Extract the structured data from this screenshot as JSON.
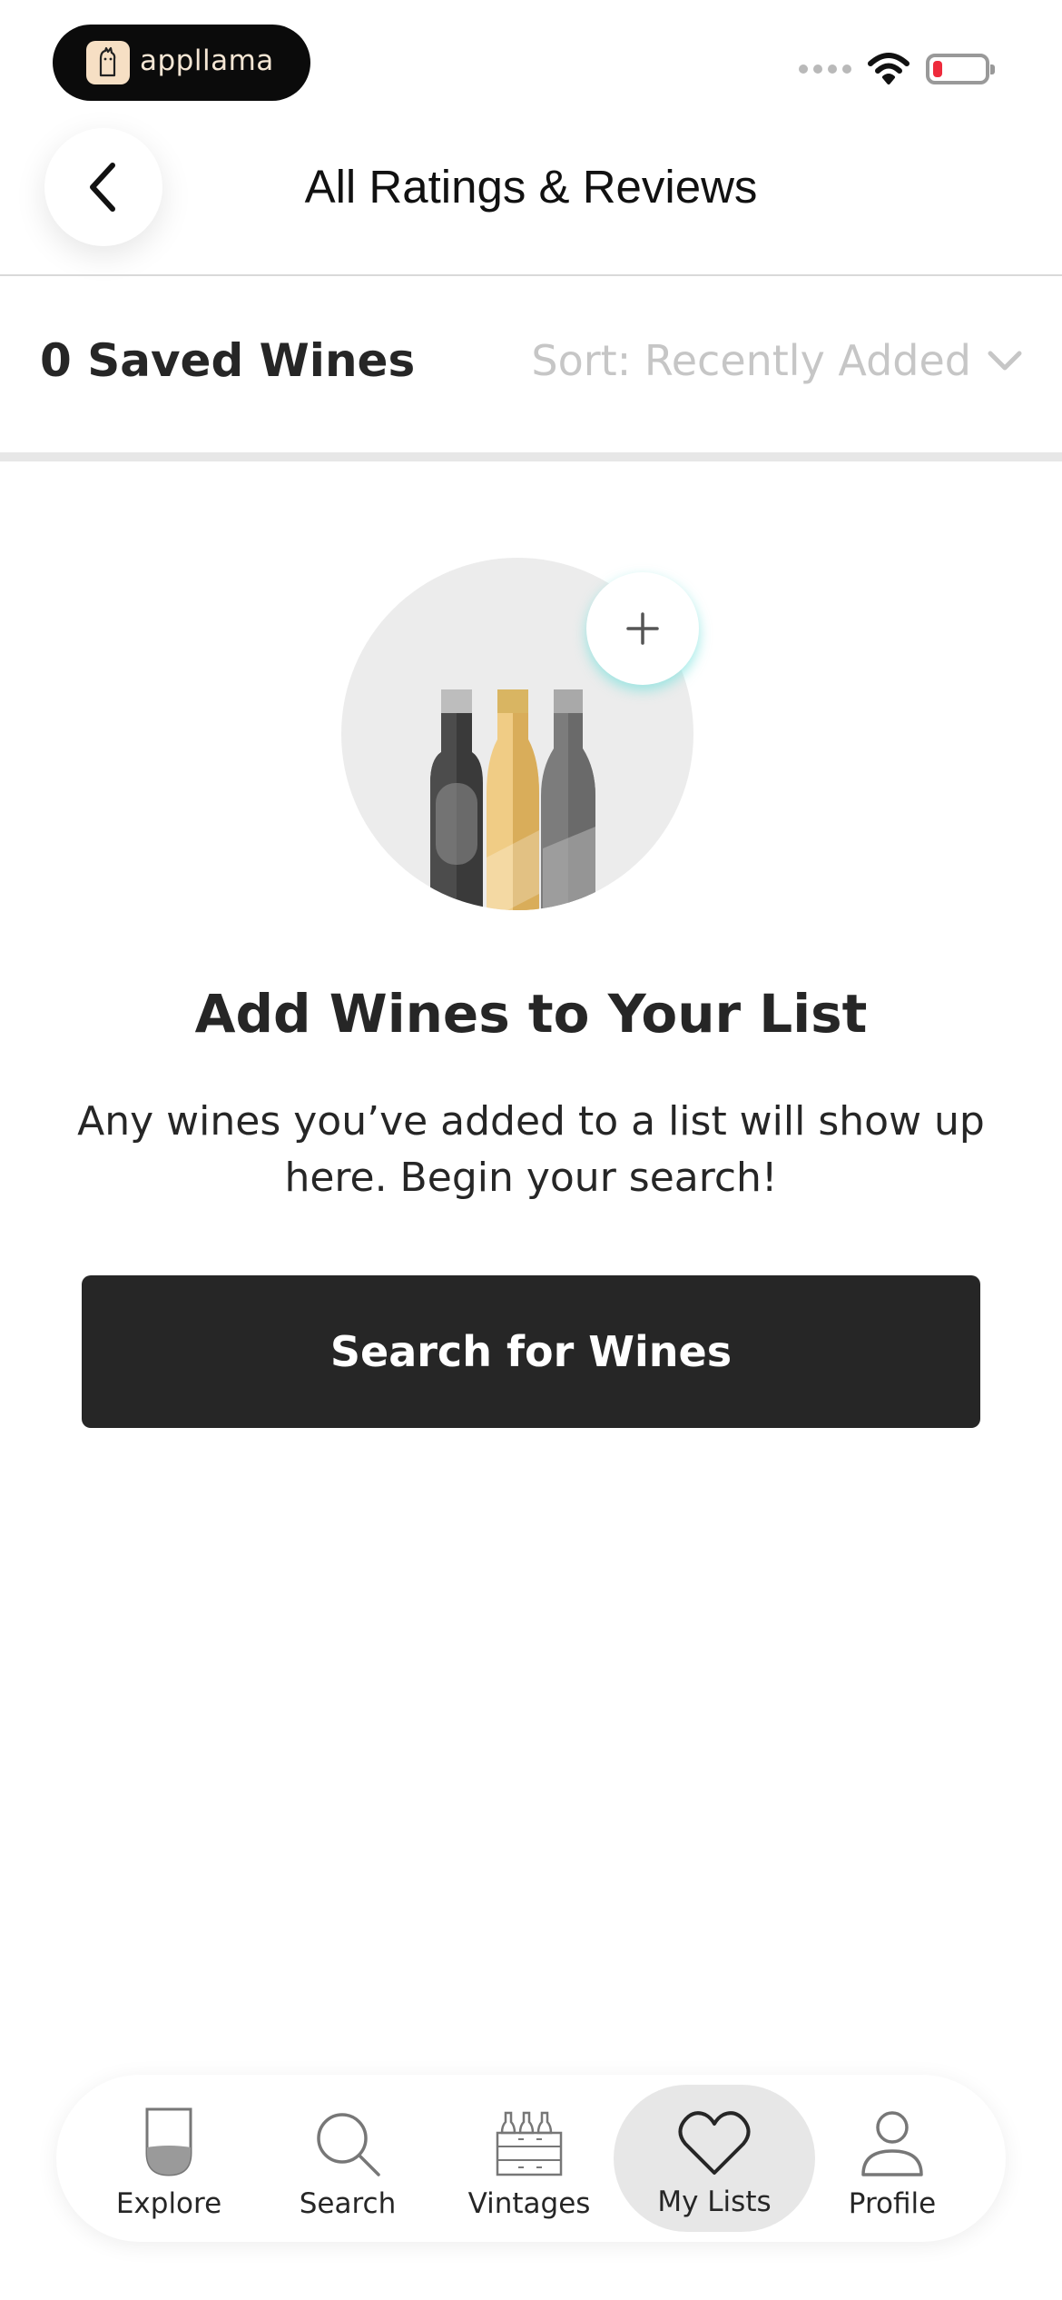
{
  "status_bar": {
    "app_badge_text": "appllama"
  },
  "header": {
    "title": "All Ratings & Reviews"
  },
  "list_summary": {
    "saved_count_label": "0 Saved Wines",
    "sort_label": "Sort: Recently Added"
  },
  "empty_state": {
    "title": "Add Wines to Your List",
    "description": "Any wines you’ve added to a list will show up here. Begin your search!",
    "button_label": "Search for Wines"
  },
  "bottom_nav": {
    "items": [
      {
        "label": "Explore",
        "icon": "wine-glass-icon"
      },
      {
        "label": "Search",
        "icon": "magnifier-icon"
      },
      {
        "label": "Vintages",
        "icon": "wine-crate-icon"
      },
      {
        "label": "My Lists",
        "icon": "heart-icon",
        "active": true
      },
      {
        "label": "Profile",
        "icon": "person-icon"
      }
    ]
  },
  "colors": {
    "primary_dark": "#262626",
    "divider": "#e7e7e7",
    "sort_text": "#c6c6c6",
    "battery_low": "#ee2b3c",
    "accent_glow": "#7de1de"
  }
}
